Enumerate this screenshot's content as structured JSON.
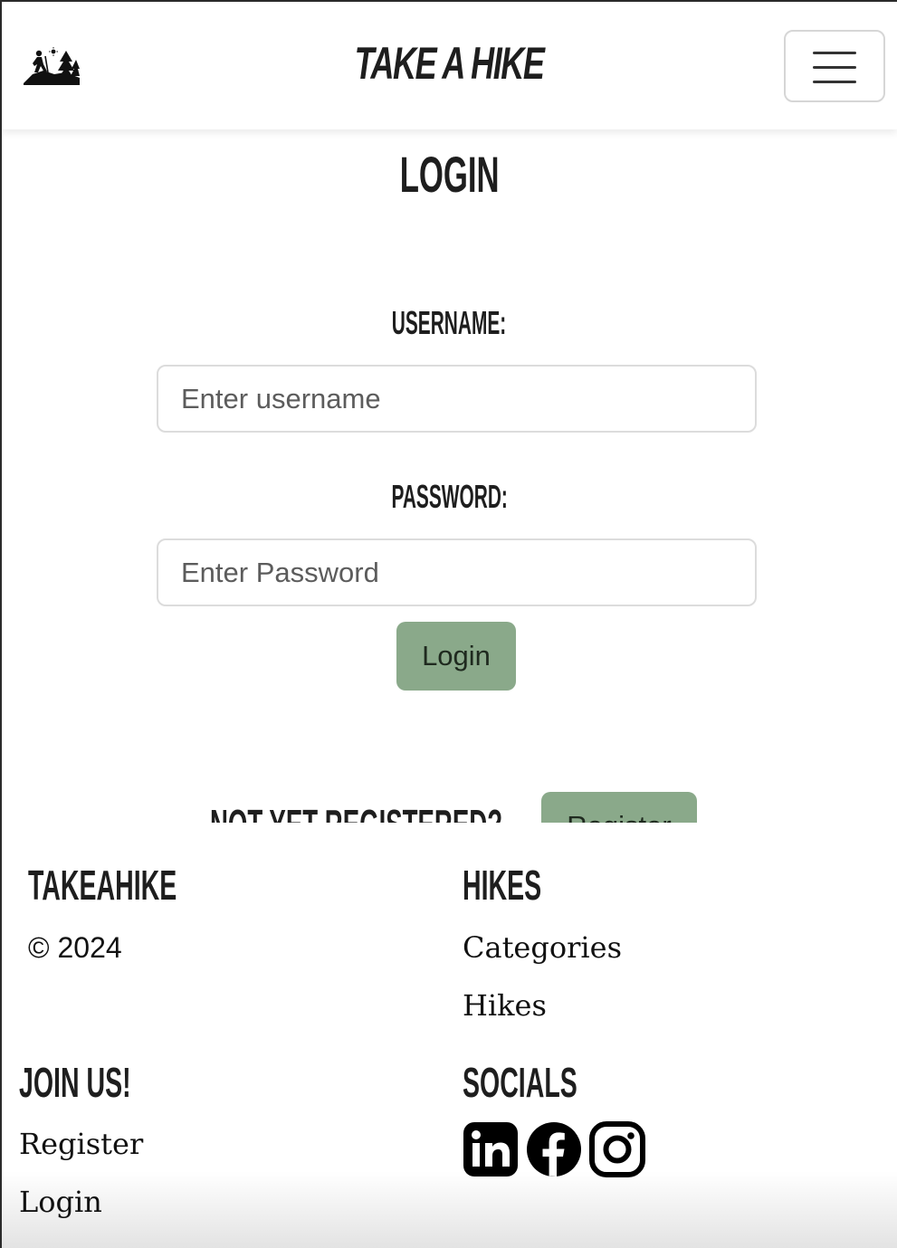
{
  "navbar": {
    "brand_title": "TAKE A HIKE",
    "logo_icon": "hiker-trees-logo-icon",
    "toggler_icon": "hamburger-menu-icon"
  },
  "main": {
    "title": "LOGIN",
    "username_label": "USERNAME:",
    "username_placeholder": "Enter username",
    "password_label": "PASSWORD:",
    "password_placeholder": "Enter Password",
    "login_button": "Login",
    "not_registered_text": "NOT YET REGISTERED?",
    "register_button": "Register"
  },
  "footer": {
    "brand_heading": "TAKEAHIKE",
    "copyright": "© 2024",
    "hikes_heading": "HIKES",
    "hikes_links": [
      "Categories",
      "Hikes"
    ],
    "join_heading": "JOIN US!",
    "join_links": [
      "Register",
      "Login"
    ],
    "socials_heading": "SOCIALS",
    "socials": [
      "linkedin-icon",
      "facebook-icon",
      "instagram-icon"
    ]
  },
  "colors": {
    "accent_green": "#8aa98a",
    "heading_text": "#1e1e1e"
  }
}
